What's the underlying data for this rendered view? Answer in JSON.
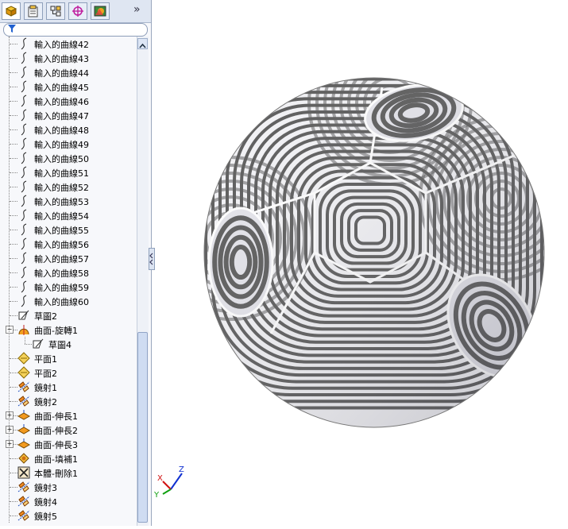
{
  "tabs": [
    {
      "icon": "feature-manager-icon",
      "active": true
    },
    {
      "icon": "property-manager-icon",
      "active": false
    },
    {
      "icon": "configuration-manager-icon",
      "active": false
    },
    {
      "icon": "dimxpert-icon",
      "active": false
    },
    {
      "icon": "display-manager-icon",
      "active": false
    }
  ],
  "tabs_more_label": "»",
  "filter": {
    "placeholder": ""
  },
  "tree": {
    "curves": [
      "輸入的曲線42",
      "輸入的曲線43",
      "輸入的曲線44",
      "輸入的曲線45",
      "輸入的曲線46",
      "輸入的曲線47",
      "輸入的曲線48",
      "輸入的曲線49",
      "輸入的曲線50",
      "輸入的曲線51",
      "輸入的曲線52",
      "輸入的曲線53",
      "輸入的曲線54",
      "輸入的曲線55",
      "輸入的曲線56",
      "輸入的曲線57",
      "輸入的曲線58",
      "輸入的曲線59",
      "輸入的曲線60"
    ],
    "sketch2": "草圖2",
    "revolve": "曲面-旋轉1",
    "expand_minus": "−",
    "expand_plus": "+",
    "sketch4": "草圖4",
    "plane1": "平面1",
    "plane2": "平面2",
    "mirror1": "鏡射1",
    "mirror2": "鏡射2",
    "extend1": "曲面-伸長1",
    "extend2": "曲面-伸長2",
    "extend3": "曲面-伸長3",
    "fill1": "曲面-填補1",
    "delete1": "本體-刪除1",
    "mirror3": "鏡射3",
    "mirror4": "鏡射4",
    "mirror5": "鏡射5"
  },
  "triad": {
    "x": "X",
    "y": "Y",
    "z": "Z"
  },
  "colors": {
    "x_axis": "#d01010",
    "y_axis": "#10a010",
    "z_axis": "#1030d0",
    "stripe_dark": "#5c5c5c",
    "stripe_light": "#f2f2f5"
  }
}
